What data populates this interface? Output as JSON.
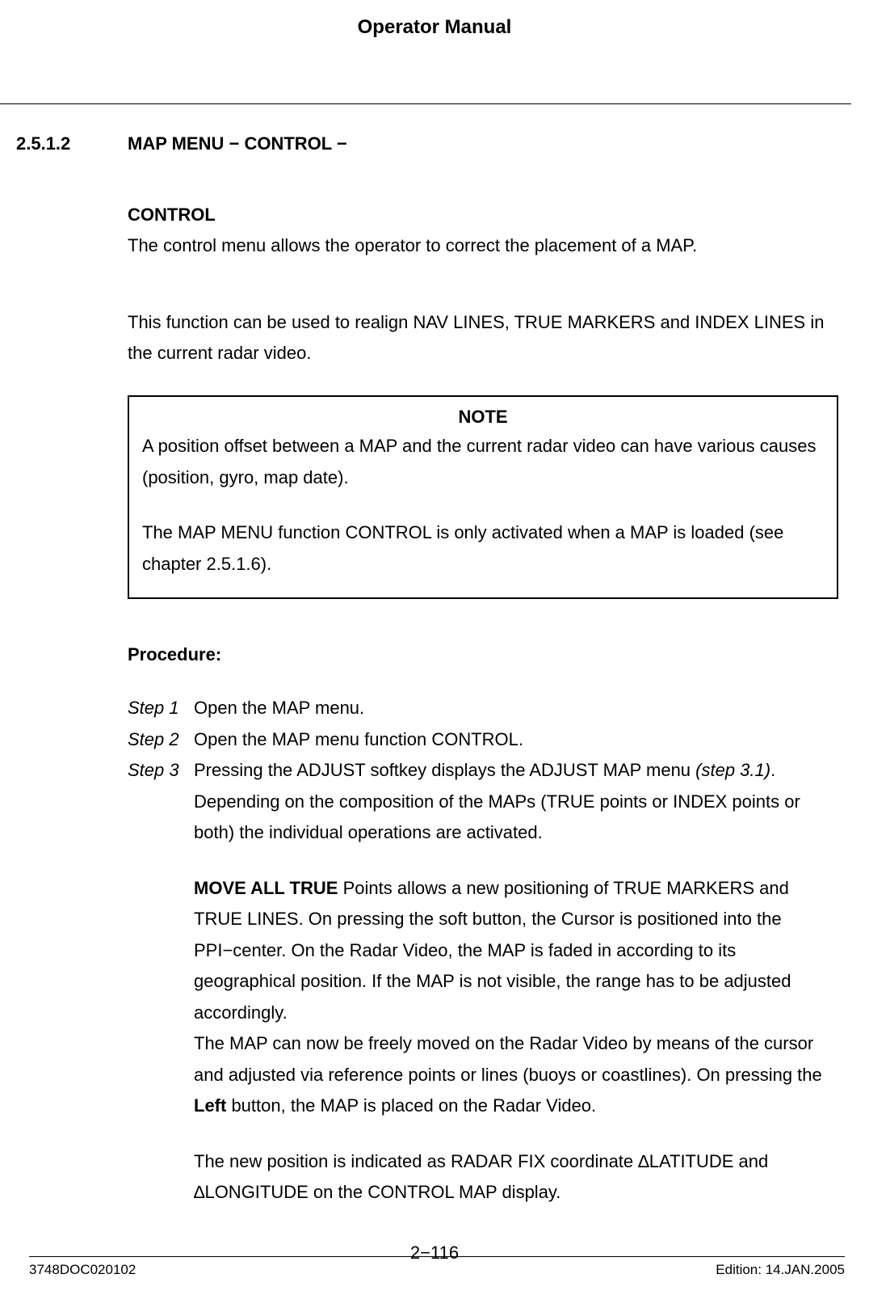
{
  "header": {
    "doc_title": "Operator Manual"
  },
  "section": {
    "number": "2.5.1.2",
    "title": "MAP MENU − CONTROL −"
  },
  "control": {
    "heading": "CONTROL",
    "para1": "The control menu allows the operator to correct the placement of a MAP.",
    "para2": "This function can be used to realign NAV LINES, TRUE MARKERS and INDEX LINES in the current radar video."
  },
  "note": {
    "title": "NOTE",
    "line1": "A position offset between a MAP and the current radar video can have various causes (position, gyro, map date).",
    "line2": "The MAP MENU function CONTROL is only activated when a MAP is loaded (see chapter 2.5.1.6)."
  },
  "procedure": {
    "heading": "Procedure:",
    "steps": [
      {
        "label": "Step 1",
        "text_a": "Open the MAP menu."
      },
      {
        "label": "Step 2",
        "text_a": "Open the MAP menu function CONTROL."
      },
      {
        "label": "Step 3",
        "text_a": "Pressing the ADJUST softkey displays the ADJUST MAP menu ",
        "text_ref": "(step 3.1)",
        "text_b": ". Depending on the composition of the MAPs (TRUE points or INDEX points or both) the individual operations are activated.",
        "move_bold": "MOVE ALL TRUE",
        "move_rest": " Points allows a new positioning of TRUE MARKERS and TRUE LINES. On pressing the soft button, the Cursor is positioned into the PPI−center. On the Radar Video, the MAP is faded in according to its geographical position. If the MAP is not visible, the range has to be adjusted accordingly.",
        "move_p2a": "The MAP can now be freely moved on the Radar Video by means of the cursor and adjusted via reference points or lines (buoys or coastlines). On pressing the ",
        "left_bold": "Left",
        "move_p2b": " button, the MAP is placed on the Radar Video.",
        "move_p3": "The new position is indicated as RADAR FIX coordinate ∆LATITUDE and ∆LONGITUDE on the CONTROL MAP display."
      }
    ]
  },
  "footer": {
    "left": "3748DOC020102",
    "center": "2−116",
    "right": "Edition: 14.JAN.2005"
  }
}
